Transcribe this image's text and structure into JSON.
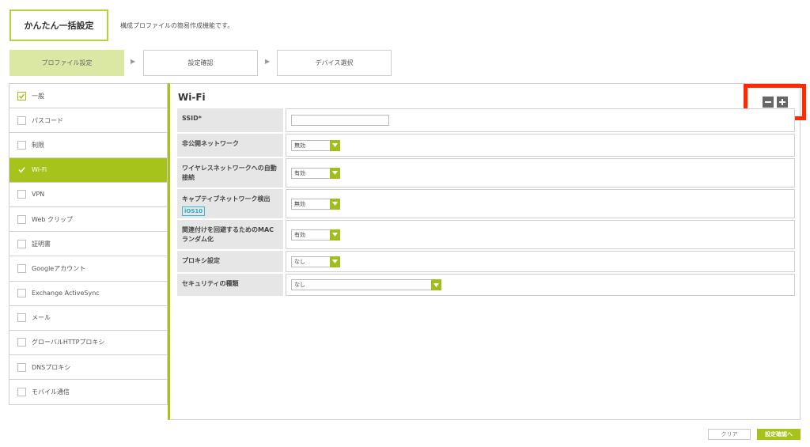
{
  "header": {
    "title": "かんたん一括設定",
    "description": "構成プロファイルの簡易作成機能です。"
  },
  "steps": [
    {
      "label": "プロファイル設定",
      "active": true
    },
    {
      "label": "設定確認",
      "active": false
    },
    {
      "label": "デバイス選択",
      "active": false
    }
  ],
  "step_arrow": "▶",
  "sidebar": {
    "items": [
      {
        "label": "一般",
        "checked": true,
        "active": false
      },
      {
        "label": "パスコード",
        "checked": false,
        "active": false
      },
      {
        "label": "制限",
        "checked": false,
        "active": false
      },
      {
        "label": "Wi-Fi",
        "checked": true,
        "active": true
      },
      {
        "label": "VPN",
        "checked": false,
        "active": false
      },
      {
        "label": "Web クリップ",
        "checked": false,
        "active": false
      },
      {
        "label": "証明書",
        "checked": false,
        "active": false
      },
      {
        "label": "Googleアカウント",
        "checked": false,
        "active": false
      },
      {
        "label": "Exchange ActiveSync",
        "checked": false,
        "active": false
      },
      {
        "label": "メール",
        "checked": false,
        "active": false
      },
      {
        "label": "グローバルHTTPプロキシ",
        "checked": false,
        "active": false
      },
      {
        "label": "DNSプロキシ",
        "checked": false,
        "active": false
      },
      {
        "label": "モバイル通信",
        "checked": false,
        "active": false
      }
    ]
  },
  "main": {
    "title": "Wi-Fi",
    "fields": {
      "ssid": {
        "label": "SSID*",
        "value": ""
      },
      "hidden_network": {
        "label": "非公開ネットワーク",
        "value": "無効"
      },
      "auto_join": {
        "label": "ワイヤレスネットワークへの自動接続",
        "value": "有効"
      },
      "captive": {
        "label": "キャプティブネットワーク検出",
        "badge": "iOS10",
        "value": "無効"
      },
      "mac_random": {
        "label": "関連付けを回避するためのMACランダム化",
        "value": "有効"
      },
      "proxy": {
        "label": "プロキシ設定",
        "value": "なし"
      },
      "security": {
        "label": "セキュリティの種類",
        "value": "なし"
      }
    }
  },
  "buttons": {
    "clear": "クリア",
    "next": "設定確認へ"
  },
  "colors": {
    "accent": "#a5c31a",
    "highlight": "#ff2a00"
  }
}
